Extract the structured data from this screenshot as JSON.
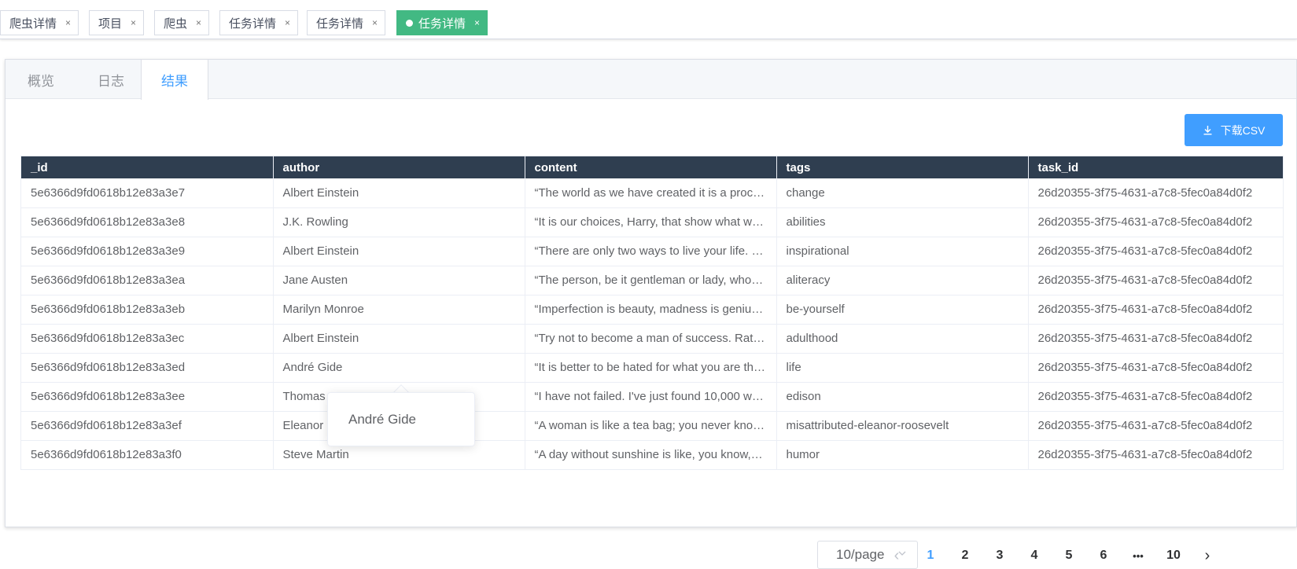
{
  "tags": [
    {
      "label": "爬虫详情",
      "active": false
    },
    {
      "label": "项目",
      "active": false
    },
    {
      "label": "爬虫",
      "active": false
    },
    {
      "label": "任务详情",
      "active": false
    },
    {
      "label": "任务详情",
      "active": false
    },
    {
      "label": "任务详情",
      "active": true
    }
  ],
  "tag_close_glyph": "×",
  "tabs": [
    {
      "label": "概览"
    },
    {
      "label": "日志"
    },
    {
      "label": "结果"
    }
  ],
  "download_button": {
    "label": "下载CSV",
    "icon": "download-icon"
  },
  "table": {
    "columns": [
      "_id",
      "author",
      "content",
      "tags",
      "task_id"
    ],
    "rows": [
      [
        "5e6366d9fd0618b12e83a3e7",
        "Albert Einstein",
        "“The world as we have created it is a proc…",
        "change",
        "26d20355-3f75-4631-a7c8-5fec0a84d0f2"
      ],
      [
        "5e6366d9fd0618b12e83a3e8",
        "J.K. Rowling",
        "“It is our choices, Harry, that show what w…",
        "abilities",
        "26d20355-3f75-4631-a7c8-5fec0a84d0f2"
      ],
      [
        "5e6366d9fd0618b12e83a3e9",
        "Albert Einstein",
        "“There are only two ways to live your life. …",
        "inspirational",
        "26d20355-3f75-4631-a7c8-5fec0a84d0f2"
      ],
      [
        "5e6366d9fd0618b12e83a3ea",
        "Jane Austen",
        "“The person, be it gentleman or lady, who…",
        "aliteracy",
        "26d20355-3f75-4631-a7c8-5fec0a84d0f2"
      ],
      [
        "5e6366d9fd0618b12e83a3eb",
        "Marilyn Monroe",
        "“Imperfection is beauty, madness is geniu…",
        "be-yourself",
        "26d20355-3f75-4631-a7c8-5fec0a84d0f2"
      ],
      [
        "5e6366d9fd0618b12e83a3ec",
        "Albert Einstein",
        "“Try not to become a man of success. Rat…",
        "adulthood",
        "26d20355-3f75-4631-a7c8-5fec0a84d0f2"
      ],
      [
        "5e6366d9fd0618b12e83a3ed",
        "André Gide",
        "“It is better to be hated for what you are th…",
        "life",
        "26d20355-3f75-4631-a7c8-5fec0a84d0f2"
      ],
      [
        "5e6366d9fd0618b12e83a3ee",
        "Thomas",
        "“I have not failed. I've just found 10,000 w…",
        "edison",
        "26d20355-3f75-4631-a7c8-5fec0a84d0f2"
      ],
      [
        "5e6366d9fd0618b12e83a3ef",
        "Eleanor",
        "“A woman is like a tea bag; you never kno…",
        "misattributed-eleanor-roosevelt",
        "26d20355-3f75-4631-a7c8-5fec0a84d0f2"
      ],
      [
        "5e6366d9fd0618b12e83a3f0",
        "Steve Martin",
        "“A day without sunshine is like, you know,…",
        "humor",
        "26d20355-3f75-4631-a7c8-5fec0a84d0f2"
      ]
    ]
  },
  "tooltip": {
    "text": "André Gide"
  },
  "pagination": {
    "page_size": "10/page",
    "prev_glyph": "‹",
    "next_glyph": "›",
    "pages": [
      "1",
      "2",
      "3",
      "4",
      "5",
      "6",
      "•••",
      "10"
    ],
    "current": "1"
  },
  "colors": {
    "accent": "#409eff",
    "active_tag": "#42b983",
    "table_header": "#2f3e50"
  }
}
